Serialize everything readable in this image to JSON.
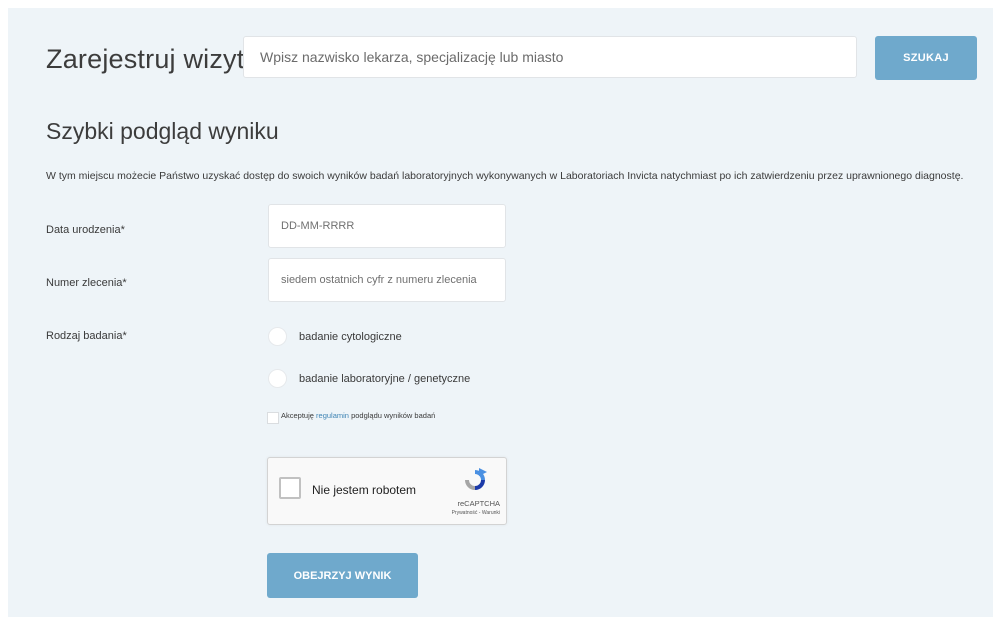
{
  "header": {
    "title": "Zarejestruj wizytę",
    "search_placeholder": "Wpisz nazwisko lekarza, specjalizację lub miasto",
    "search_button": "SZUKAJ"
  },
  "section": {
    "title": "Szybki podgląd wyniku",
    "intro": "W tym miejscu możecie Państwo uzyskać dostęp do swoich wyników badań laboratoryjnych wykonywanych w Laboratoriach Invicta natychmiast po ich zatwierdzeniu przez uprawnionego diagnostę."
  },
  "form": {
    "birthdate": {
      "label": "Data urodzenia*",
      "placeholder": "DD-MM-RRRR",
      "value": ""
    },
    "order_number": {
      "label": "Numer zlecenia*",
      "placeholder": "siedem ostatnich cyfr z numeru zlecenia",
      "value": ""
    },
    "test_type": {
      "label": "Rodzaj badania*",
      "options": [
        "badanie cytologiczne",
        "badanie laboratoryjne / genetyczne"
      ]
    },
    "consent": {
      "prefix": "Akceptuję",
      "link": "regulamin",
      "suffix": "podglądu wyników badań"
    },
    "captcha": {
      "label": "Nie jestem robotem",
      "brand": "reCAPTCHA",
      "links": "Prywatność - Warunki"
    },
    "submit": "OBEJRZYJ WYNIK"
  },
  "colors": {
    "accent": "#6fa9cc",
    "panel_background": "#eef4f8",
    "link": "#3f84b4"
  }
}
